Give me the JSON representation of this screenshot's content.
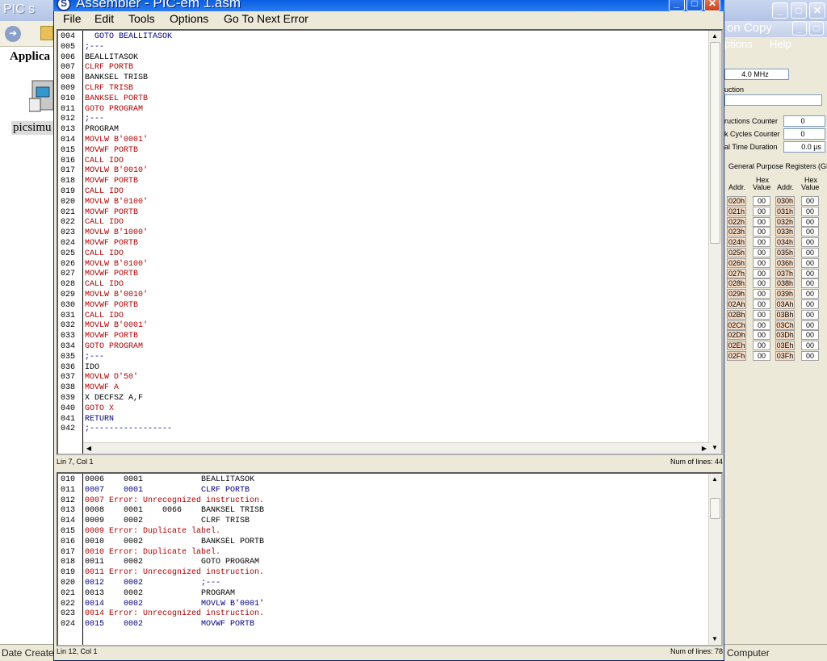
{
  "background_window": {
    "title": "PIC s",
    "address_label": "Applica",
    "icon_label": "picsimu",
    "status_left": "Date Create",
    "status_right": "Computer"
  },
  "simulator": {
    "title": "on Copy",
    "menu": [
      "ptions",
      "Help"
    ],
    "clock": "4.0 MHz",
    "instruction_label": "uction",
    "instructions_counter_label": "ructions Counter",
    "instructions_counter_value": "0",
    "clock_cycles_label": "k Cycles Counter",
    "clock_cycles_value": "0",
    "time_duration_label": "al Time Duration",
    "time_duration_value": "0.0 µs",
    "gpr_title": "General Purpose Registers (GPR",
    "col_headers": {
      "addr": "Addr.",
      "hex_top": "Hex",
      "hex_bottom": "Value"
    },
    "registers_left": [
      {
        "addr": "020h",
        "val": "00"
      },
      {
        "addr": "021h",
        "val": "00"
      },
      {
        "addr": "022h",
        "val": "00"
      },
      {
        "addr": "023h",
        "val": "00"
      },
      {
        "addr": "024h",
        "val": "00"
      },
      {
        "addr": "025h",
        "val": "00"
      },
      {
        "addr": "026h",
        "val": "00"
      },
      {
        "addr": "027h",
        "val": "00"
      },
      {
        "addr": "028h",
        "val": "00"
      },
      {
        "addr": "029h",
        "val": "00"
      },
      {
        "addr": "02Ah",
        "val": "00"
      },
      {
        "addr": "02Bh",
        "val": "00"
      },
      {
        "addr": "02Ch",
        "val": "00"
      },
      {
        "addr": "02Dh",
        "val": "00"
      },
      {
        "addr": "02Eh",
        "val": "00"
      },
      {
        "addr": "02Fh",
        "val": "00"
      }
    ],
    "registers_right": [
      {
        "addr": "030h",
        "val": "00"
      },
      {
        "addr": "031h",
        "val": "00"
      },
      {
        "addr": "032h",
        "val": "00"
      },
      {
        "addr": "033h",
        "val": "00"
      },
      {
        "addr": "034h",
        "val": "00"
      },
      {
        "addr": "035h",
        "val": "00"
      },
      {
        "addr": "036h",
        "val": "00"
      },
      {
        "addr": "037h",
        "val": "00"
      },
      {
        "addr": "038h",
        "val": "00"
      },
      {
        "addr": "039h",
        "val": "00"
      },
      {
        "addr": "03Ah",
        "val": "00"
      },
      {
        "addr": "03Bh",
        "val": "00"
      },
      {
        "addr": "03Ch",
        "val": "00"
      },
      {
        "addr": "03Dh",
        "val": "00"
      },
      {
        "addr": "03Eh",
        "val": "00"
      },
      {
        "addr": "03Fh",
        "val": "00"
      }
    ]
  },
  "assembler": {
    "title": "Assembler - PIC-em 1.asm",
    "menu": [
      "File",
      "Edit",
      "Tools",
      "Options",
      "Go To Next Error"
    ],
    "editor": {
      "lines": [
        {
          "n": "004",
          "text": "  GOTO BEALLITASOK",
          "color": "blu"
        },
        {
          "n": "005",
          "text": ";---",
          "color": "blu"
        },
        {
          "n": "006",
          "text": "BEALLITASOK",
          "color": "blk"
        },
        {
          "n": "007",
          "text": "CLRF PORTB",
          "color": "red"
        },
        {
          "n": "008",
          "text": "BANKSEL TRISB",
          "color": "blk"
        },
        {
          "n": "009",
          "text": "CLRF TRISB",
          "color": "red"
        },
        {
          "n": "010",
          "text": "BANKSEL PORTB",
          "color": "red"
        },
        {
          "n": "011",
          "text": "GOTO PROGRAM",
          "color": "red"
        },
        {
          "n": "012",
          "text": ";---",
          "color": "blu"
        },
        {
          "n": "013",
          "text": "PROGRAM",
          "color": "blk"
        },
        {
          "n": "014",
          "text": "MOVLW B'0001'",
          "color": "red"
        },
        {
          "n": "015",
          "text": "MOVWF PORTB",
          "color": "red"
        },
        {
          "n": "016",
          "text": "CALL IDO",
          "color": "red"
        },
        {
          "n": "017",
          "text": "MOVLW B'0010'",
          "color": "red"
        },
        {
          "n": "018",
          "text": "MOVWF PORTB",
          "color": "red"
        },
        {
          "n": "019",
          "text": "CALL IDO",
          "color": "red"
        },
        {
          "n": "020",
          "text": "MOVLW B'0100'",
          "color": "red"
        },
        {
          "n": "021",
          "text": "MOVWF PORTB",
          "color": "red"
        },
        {
          "n": "022",
          "text": "CALL IDO",
          "color": "red"
        },
        {
          "n": "023",
          "text": "MOVLW B'1000'",
          "color": "red"
        },
        {
          "n": "024",
          "text": "MOVWF PORTB",
          "color": "red"
        },
        {
          "n": "025",
          "text": "CALL IDO",
          "color": "red"
        },
        {
          "n": "026",
          "text": "MOVLW B'0100'",
          "color": "red"
        },
        {
          "n": "027",
          "text": "MOVWF PORTB",
          "color": "red"
        },
        {
          "n": "028",
          "text": "CALL IDO",
          "color": "red"
        },
        {
          "n": "029",
          "text": "MOVLW B'0010'",
          "color": "red"
        },
        {
          "n": "030",
          "text": "MOVWF PORTB",
          "color": "red"
        },
        {
          "n": "031",
          "text": "CALL IDO",
          "color": "red"
        },
        {
          "n": "032",
          "text": "MOVLW B'0001'",
          "color": "red"
        },
        {
          "n": "033",
          "text": "MOVWF PORTB",
          "color": "red"
        },
        {
          "n": "034",
          "text": "GOTO PROGRAM",
          "color": "red"
        },
        {
          "n": "035",
          "text": ";---",
          "color": "blu"
        },
        {
          "n": "036",
          "text": "IDO",
          "color": "blk"
        },
        {
          "n": "037",
          "text": "MOVLW D'50'",
          "color": "red"
        },
        {
          "n": "038",
          "text": "MOVWF A",
          "color": "red"
        },
        {
          "n": "039",
          "text": "X DECFSZ A,F",
          "color": "blk"
        },
        {
          "n": "040",
          "text": "GOTO X",
          "color": "red"
        },
        {
          "n": "041",
          "text": "RETURN",
          "color": "blu"
        },
        {
          "n": "042",
          "text": ";-----------------",
          "color": "blu"
        }
      ],
      "status_left": "Lin 7, Col 1",
      "status_right": "Num of lines: 44"
    },
    "output": {
      "lines": [
        {
          "n": "010",
          "text": "0006    0001            BEALLITASOK",
          "color": "blk"
        },
        {
          "n": "011",
          "text": "0007    0001            CLRF PORTB",
          "color": "blu"
        },
        {
          "n": "012",
          "text": "0007 Error: Unrecognized instruction.",
          "color": "red"
        },
        {
          "n": "013",
          "text": "0008    0001    0066    BANKSEL TRISB",
          "color": "blk"
        },
        {
          "n": "014",
          "text": "0009    0002            CLRF TRISB",
          "color": "blk"
        },
        {
          "n": "015",
          "text": "0009 Error: Duplicate label.",
          "color": "red"
        },
        {
          "n": "016",
          "text": "0010    0002            BANKSEL PORTB",
          "color": "blk"
        },
        {
          "n": "017",
          "text": "0010 Error: Duplicate label.",
          "color": "red"
        },
        {
          "n": "018",
          "text": "0011    0002            GOTO PROGRAM",
          "color": "blk"
        },
        {
          "n": "019",
          "text": "0011 Error: Unrecognized instruction.",
          "color": "red"
        },
        {
          "n": "020",
          "text": "0012    0002            ;---",
          "color": "blu"
        },
        {
          "n": "021",
          "text": "0013    0002            PROGRAM",
          "color": "blk"
        },
        {
          "n": "022",
          "text": "0014    0002            MOVLW B'0001'",
          "color": "blu"
        },
        {
          "n": "023",
          "text": "0014 Error: Unrecognized instruction.",
          "color": "red"
        },
        {
          "n": "024",
          "text": "0015    0002            MOVWF PORTB",
          "color": "blu"
        }
      ],
      "status_left": "Lin 12, Col 1",
      "status_right": "Num of lines: 78"
    }
  },
  "colors": {
    "title_blue": "#0a5fe0",
    "error_red": "#b00000",
    "keyword_blue": "#000080",
    "register_addr_bg": "#f6dcc6"
  }
}
